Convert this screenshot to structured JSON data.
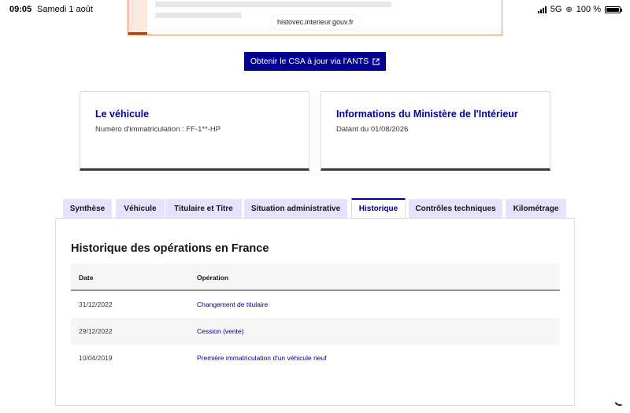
{
  "status_bar": {
    "time": "09:05",
    "date": "Samedi 1 août",
    "network": "5G",
    "battery": "100 %",
    "battery_level": 1.0
  },
  "browser": {
    "url": "histovec.interieur.gouv.fr"
  },
  "cta": {
    "label": "Obtenir le CSA à jour via l'ANTS",
    "icon": "external-link-icon",
    "color": "#000091"
  },
  "cards": {
    "vehicle": {
      "title": "Le véhicule",
      "description": "Numéro d'immatriculation : FF-1**-HP"
    },
    "ministry": {
      "title": "Informations du Ministère de l'Intérieur",
      "description": "Datant du 01/08/2026"
    }
  },
  "tabs": [
    {
      "label": "Synthèse",
      "active": false
    },
    {
      "label": "Véhicule",
      "active": false
    },
    {
      "label": "Titulaire et Titre",
      "active": false
    },
    {
      "label": "Situation administrative",
      "active": false
    },
    {
      "label": "Historique",
      "active": true
    },
    {
      "label": "Contrôles techniques",
      "active": false
    },
    {
      "label": "Kilométrage",
      "active": false
    }
  ],
  "history": {
    "title": "Historique des opérations en France",
    "columns": [
      "Date",
      "Opération"
    ],
    "rows": [
      {
        "date": "31/12/2022",
        "operation": "Changement de titulaire"
      },
      {
        "date": "29/12/2022",
        "operation": "Cession (vente)"
      },
      {
        "date": "10/04/2019",
        "operation": "Première immatriculation d'un véhicule neuf"
      }
    ]
  },
  "colors": {
    "brand": "#000091",
    "tab_bg": "#e3e3fd",
    "alert_border": "#e88b5d",
    "alert_accent": "#b34000"
  }
}
